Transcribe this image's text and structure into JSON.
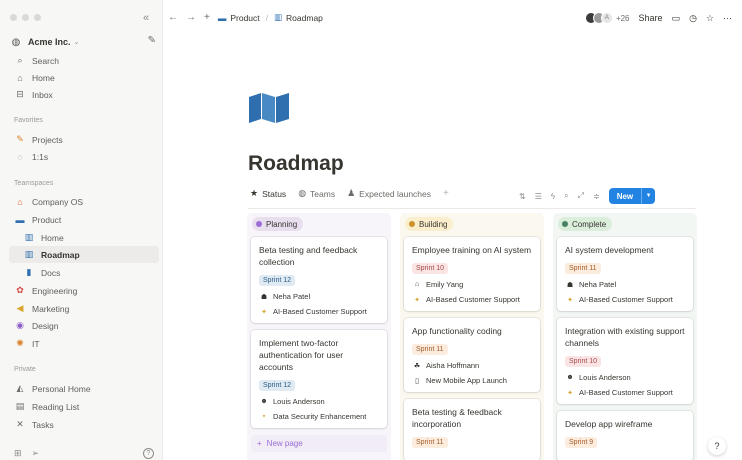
{
  "sidebar": {
    "workspace": "Acme Inc.",
    "top_items": [
      {
        "label": "Search",
        "icon": "search-icon"
      },
      {
        "label": "Home",
        "icon": "home-icon"
      },
      {
        "label": "Inbox",
        "icon": "inbox-icon"
      }
    ],
    "favorites_label": "Favorites",
    "favorites": [
      {
        "label": "Projects",
        "icon": "pencil-icon"
      },
      {
        "label": "1:1s",
        "icon": "chat-icon"
      }
    ],
    "teamspaces_label": "Teamspaces",
    "teamspaces": [
      {
        "label": "Company OS",
        "icon": "house-icon"
      },
      {
        "label": "Product",
        "icon": "laptop-icon"
      },
      {
        "label": "Home",
        "icon": "map-icon"
      },
      {
        "label": "Roadmap",
        "icon": "map-icon"
      },
      {
        "label": "Docs",
        "icon": "bookmark-icon"
      },
      {
        "label": "Engineering",
        "icon": "gear-icon"
      },
      {
        "label": "Marketing",
        "icon": "megaphone-icon"
      },
      {
        "label": "Design",
        "icon": "palette-icon"
      },
      {
        "label": "IT",
        "icon": "bug-icon"
      }
    ],
    "private_label": "Private",
    "private": [
      {
        "label": "Personal Home",
        "icon": "leaf-icon"
      },
      {
        "label": "Reading List",
        "icon": "book-icon"
      },
      {
        "label": "Tasks",
        "icon": "tools-icon"
      }
    ]
  },
  "topbar": {
    "breadcrumb": [
      "Product",
      "Roadmap"
    ],
    "avatar_initial": "A",
    "share_count": "+26",
    "share_label": "Share"
  },
  "page": {
    "title": "Roadmap"
  },
  "views": {
    "tabs": [
      "Status",
      "Teams",
      "Expected launches"
    ],
    "new_label": "New"
  },
  "board": {
    "columns": [
      {
        "name": "Planning",
        "cards": [
          {
            "title": "Beta testing and feedback collection",
            "sprint": "Sprint 12",
            "owner": "Neha Patel",
            "project": "AI-Based Customer Support"
          },
          {
            "title": "Implement two-factor authentication for user accounts",
            "sprint": "Sprint 12",
            "owner": "Louis Anderson",
            "project": "Data Security Enhancement"
          }
        ],
        "new_page": "New page"
      },
      {
        "name": "Building",
        "cards": [
          {
            "title": "Employee training on AI system",
            "sprint": "Sprint 10",
            "owner": "Emily Yang",
            "project": "AI-Based Customer Support"
          },
          {
            "title": "App functionality coding",
            "sprint": "Sprint 11",
            "owner": "Aisha Hoffmann",
            "project": "New Mobile App Launch"
          },
          {
            "title": "Beta testing & feedback incorporation",
            "sprint": "Sprint 11"
          }
        ]
      },
      {
        "name": "Complete",
        "cards": [
          {
            "title": "AI system development",
            "sprint": "Sprint 11",
            "owner": "Neha Patel",
            "project": "AI-Based Customer Support"
          },
          {
            "title": "Integration with existing support channels",
            "sprint": "Sprint 10",
            "owner": "Louis Anderson",
            "project": "AI-Based Customer Support"
          },
          {
            "title": "Develop app wireframe",
            "sprint": "Sprint 9"
          }
        ]
      }
    ]
  }
}
